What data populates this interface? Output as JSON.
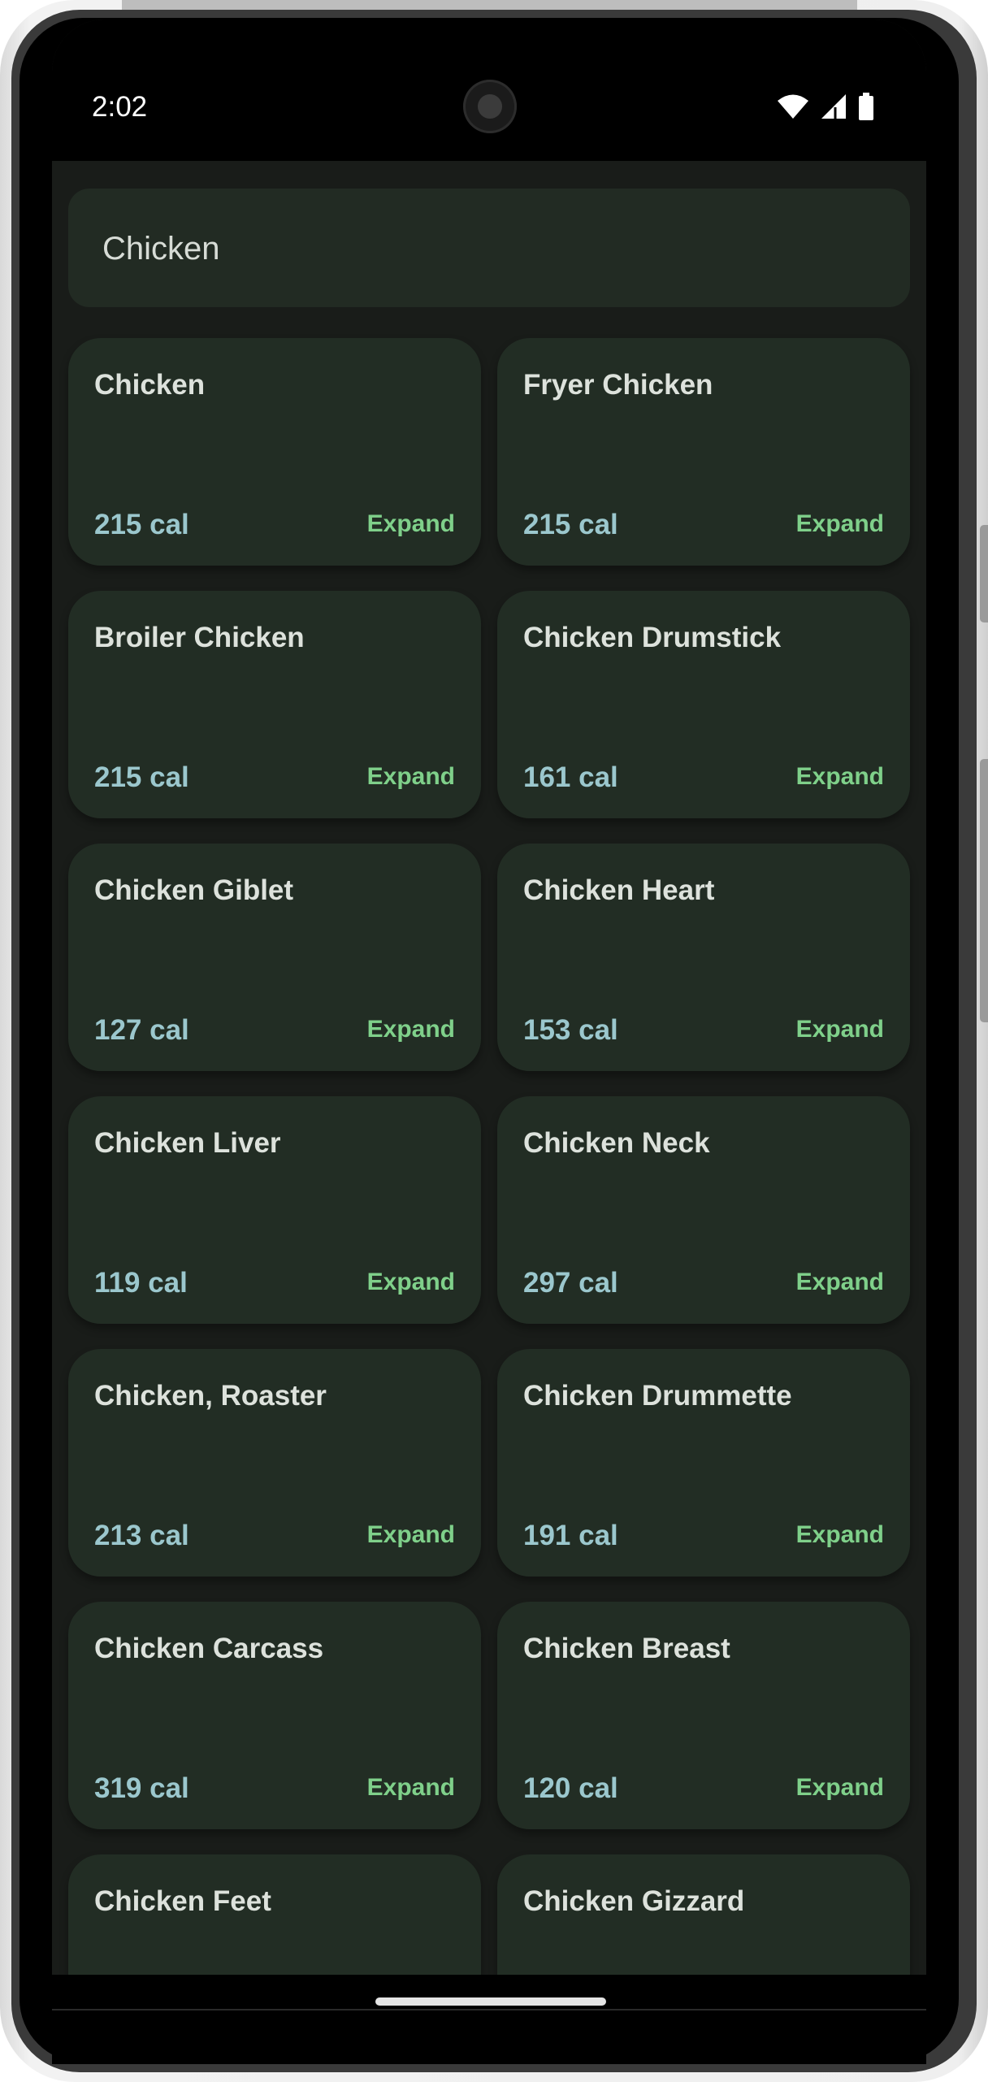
{
  "status_bar": {
    "time": "2:02",
    "icons": [
      "wifi-icon",
      "cellular-signal-icon",
      "battery-icon"
    ]
  },
  "search": {
    "value": "Chicken"
  },
  "colors": {
    "screen_bg": "#191c19",
    "card_bg": "#222d24",
    "calorie_text": "#9bc7cd",
    "expand_text": "#7fd08a",
    "title_text": "#dde2dc"
  },
  "results": [
    {
      "name": "Chicken",
      "calories": "215 cal",
      "action": "Expand"
    },
    {
      "name": "Fryer Chicken",
      "calories": "215 cal",
      "action": "Expand"
    },
    {
      "name": "Broiler Chicken",
      "calories": "215 cal",
      "action": "Expand"
    },
    {
      "name": "Chicken Drumstick",
      "calories": "161 cal",
      "action": "Expand"
    },
    {
      "name": "Chicken Giblet",
      "calories": "127 cal",
      "action": "Expand"
    },
    {
      "name": "Chicken Heart",
      "calories": "153 cal",
      "action": "Expand"
    },
    {
      "name": "Chicken Liver",
      "calories": "119 cal",
      "action": "Expand"
    },
    {
      "name": "Chicken Neck",
      "calories": "297 cal",
      "action": "Expand"
    },
    {
      "name": "Chicken, Roaster",
      "calories": "213 cal",
      "action": "Expand"
    },
    {
      "name": "Chicken Drummette",
      "calories": "191 cal",
      "action": "Expand"
    },
    {
      "name": "Chicken Carcass",
      "calories": "319 cal",
      "action": "Expand"
    },
    {
      "name": "Chicken Breast",
      "calories": "120 cal",
      "action": "Expand"
    },
    {
      "name": "Chicken Feet",
      "calories": "",
      "action": ""
    },
    {
      "name": "Chicken Gizzard",
      "calories": "",
      "action": ""
    }
  ]
}
